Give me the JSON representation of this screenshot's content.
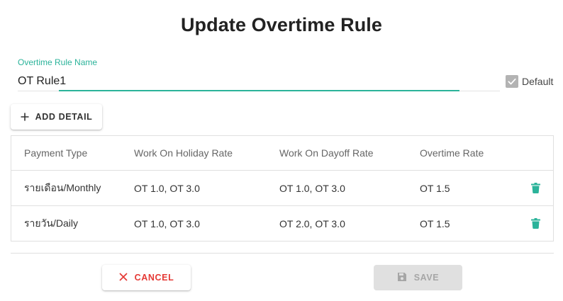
{
  "dialog": {
    "title": "Update Overtime Rule"
  },
  "form": {
    "name_label": "Overtime Rule Name",
    "name_value": "OT Rule1",
    "default_label": "Default",
    "default_checked": true
  },
  "toolbar": {
    "add_detail_label": "ADD DETAIL",
    "add_icon": "plus-icon"
  },
  "table": {
    "columns": [
      "Payment Type",
      "Work On Holiday Rate",
      "Work On Dayoff Rate",
      "Overtime Rate"
    ],
    "rows": [
      {
        "payment_type": "รายเดือน/Monthly",
        "holiday_rate": "OT 1.0, OT 3.0",
        "dayoff_rate": "OT 1.0, OT 3.0",
        "overtime_rate": "OT 1.5"
      },
      {
        "payment_type": "รายวัน/Daily",
        "holiday_rate": "OT 1.0, OT 3.0",
        "dayoff_rate": "OT 2.0, OT 3.0",
        "overtime_rate": "OT 1.5"
      }
    ],
    "row_action_icon": "trash-icon"
  },
  "footer": {
    "cancel_label": "CANCEL",
    "save_label": "SAVE",
    "save_disabled": true
  },
  "colors": {
    "accent": "#2bb39a",
    "danger": "#e53935",
    "disabled_bg": "#e0e0e0",
    "disabled_text": "#a6a6a6"
  }
}
